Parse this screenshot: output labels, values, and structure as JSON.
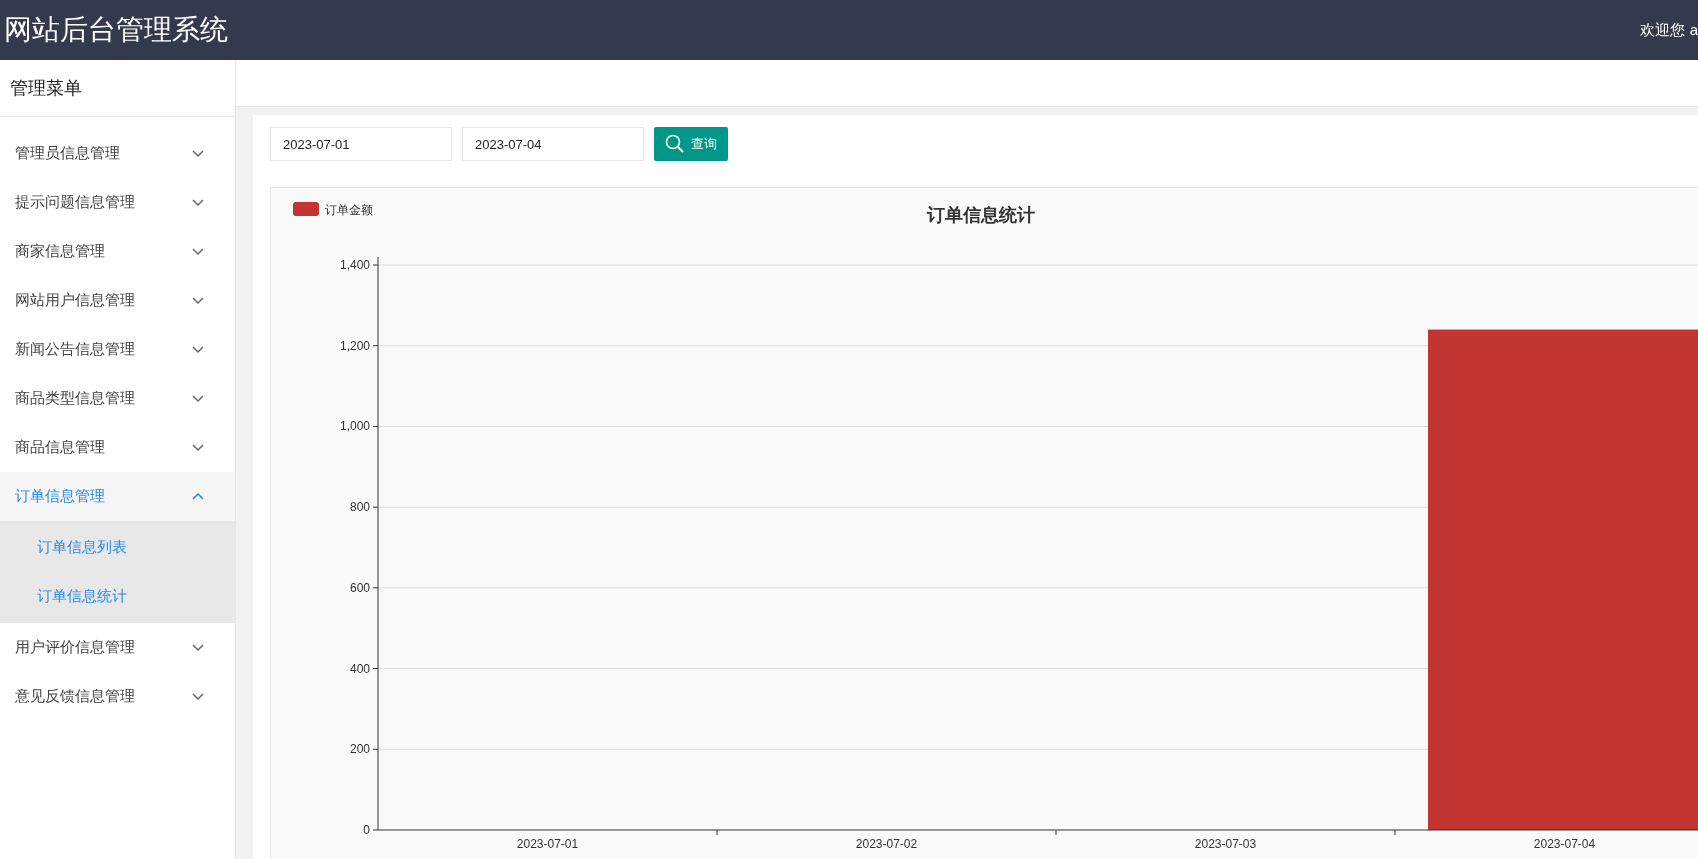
{
  "header": {
    "title": "网站后台管理系统",
    "welcome": "欢迎您 a"
  },
  "sidebar": {
    "title": "管理菜单",
    "items": [
      {
        "label": "管理员信息管理",
        "expanded": false
      },
      {
        "label": "提示问题信息管理",
        "expanded": false
      },
      {
        "label": "商家信息管理",
        "expanded": false
      },
      {
        "label": "网站用户信息管理",
        "expanded": false
      },
      {
        "label": "新闻公告信息管理",
        "expanded": false
      },
      {
        "label": "商品类型信息管理",
        "expanded": false
      },
      {
        "label": "商品信息管理",
        "expanded": false
      },
      {
        "label": "订单信息管理",
        "expanded": true,
        "children": [
          {
            "label": "订单信息列表"
          },
          {
            "label": "订单信息统计"
          }
        ]
      },
      {
        "label": "用户评价信息管理",
        "expanded": false
      },
      {
        "label": "意见反馈信息管理",
        "expanded": false
      }
    ]
  },
  "filters": {
    "start_date": "2023-07-01",
    "end_date": "2023-07-04",
    "button": "查询"
  },
  "chart": {
    "chart_data": {
      "type": "bar",
      "title": "订单信息统计",
      "categories": [
        "2023-07-01",
        "2023-07-02",
        "2023-07-03",
        "2023-07-04"
      ],
      "series": [
        {
          "name": "订单金额",
          "color": "#c23531",
          "values": [
            0,
            0,
            0,
            1240
          ]
        }
      ],
      "grid": true,
      "ylim": [
        0,
        1400
      ],
      "yticks": [
        {
          "value": 0,
          "label": "0"
        },
        {
          "value": 200,
          "label": "200"
        },
        {
          "value": 400,
          "label": "400"
        },
        {
          "value": 600,
          "label": "600"
        },
        {
          "value": 800,
          "label": "800"
        },
        {
          "value": 1000,
          "label": "1,000"
        },
        {
          "value": 1200,
          "label": "1,200"
        },
        {
          "value": 1400,
          "label": "1,400"
        }
      ]
    }
  }
}
